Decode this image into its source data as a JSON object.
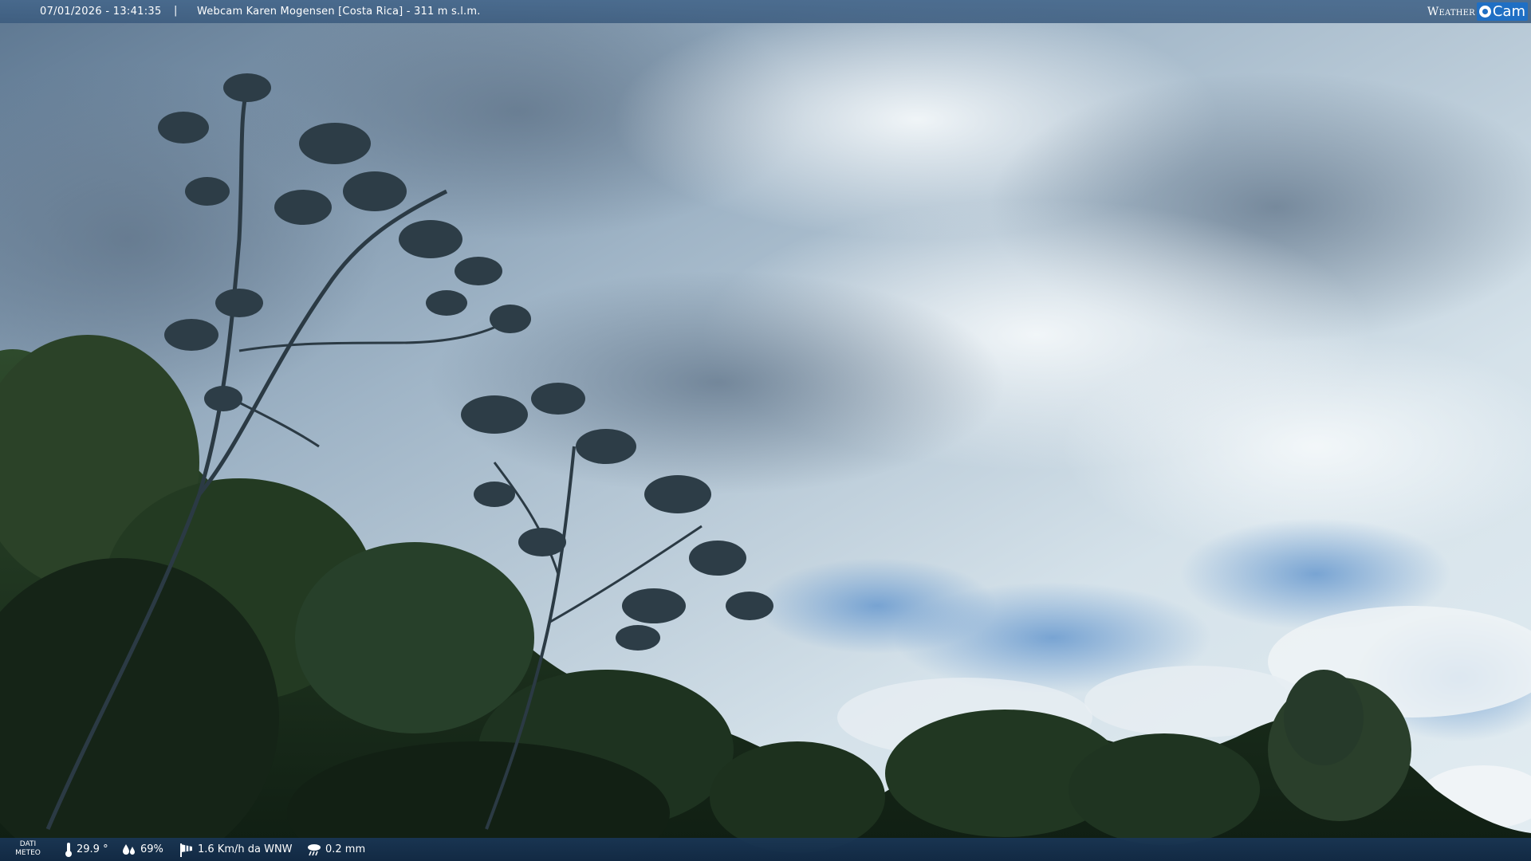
{
  "header": {
    "datetime": "07/01/2026 - 13:41:35",
    "separator": "|",
    "title": "Webcam Karen Mogensen [Costa Rica] - 311 m s.l.m."
  },
  "logo": {
    "word_left": "Weather",
    "word_right": "Cam",
    "brand_color": "#1f6fc4"
  },
  "footer": {
    "label_line1": "DATI",
    "label_line2": "METEO",
    "temperature": "29.9 °",
    "humidity": "69%",
    "wind": "1.6 Km/h da WNW",
    "rain": "0.2 mm",
    "icons": {
      "temperature": "thermometer-icon",
      "humidity": "raindrops-icon",
      "wind": "wind-sock-icon",
      "rain": "rain-cloud-icon"
    }
  }
}
